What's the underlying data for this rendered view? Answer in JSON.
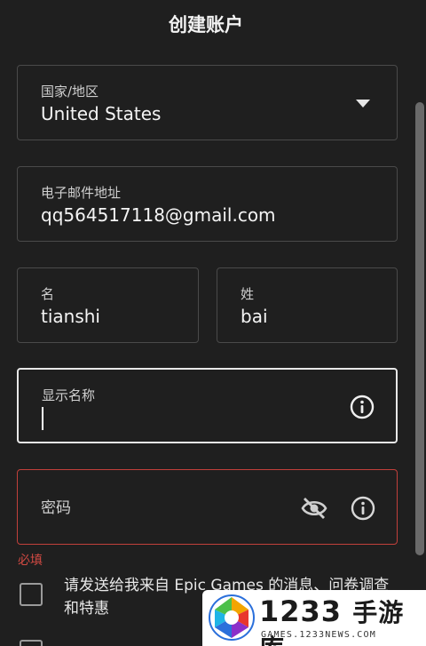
{
  "header": {
    "title": "创建账户"
  },
  "form": {
    "country": {
      "label": "国家/地区",
      "value": "United States"
    },
    "email": {
      "label": "电子邮件地址",
      "value": "qq564517118@gmail.com"
    },
    "first_name": {
      "label": "名",
      "value": "tianshi"
    },
    "last_name": {
      "label": "姓",
      "value": "bai"
    },
    "display_name": {
      "label": "显示名称",
      "value": ""
    },
    "password": {
      "label": "密码",
      "value": ""
    },
    "required_msg": "必填",
    "consent_text": "请发送给我来自 Epic Games 的消息、问卷调查和特惠"
  },
  "icons": {
    "dropdown": "chevron-down-icon",
    "info": "info-icon",
    "hide_password": "eye-off-icon"
  },
  "colors": {
    "background": "#1f1f1f",
    "error": "#c2403b",
    "text": "#ffffff"
  },
  "watermark": {
    "brand": "1233",
    "brand_cn": "手游库",
    "domain": "GAMES.1233NEWS.COM"
  }
}
